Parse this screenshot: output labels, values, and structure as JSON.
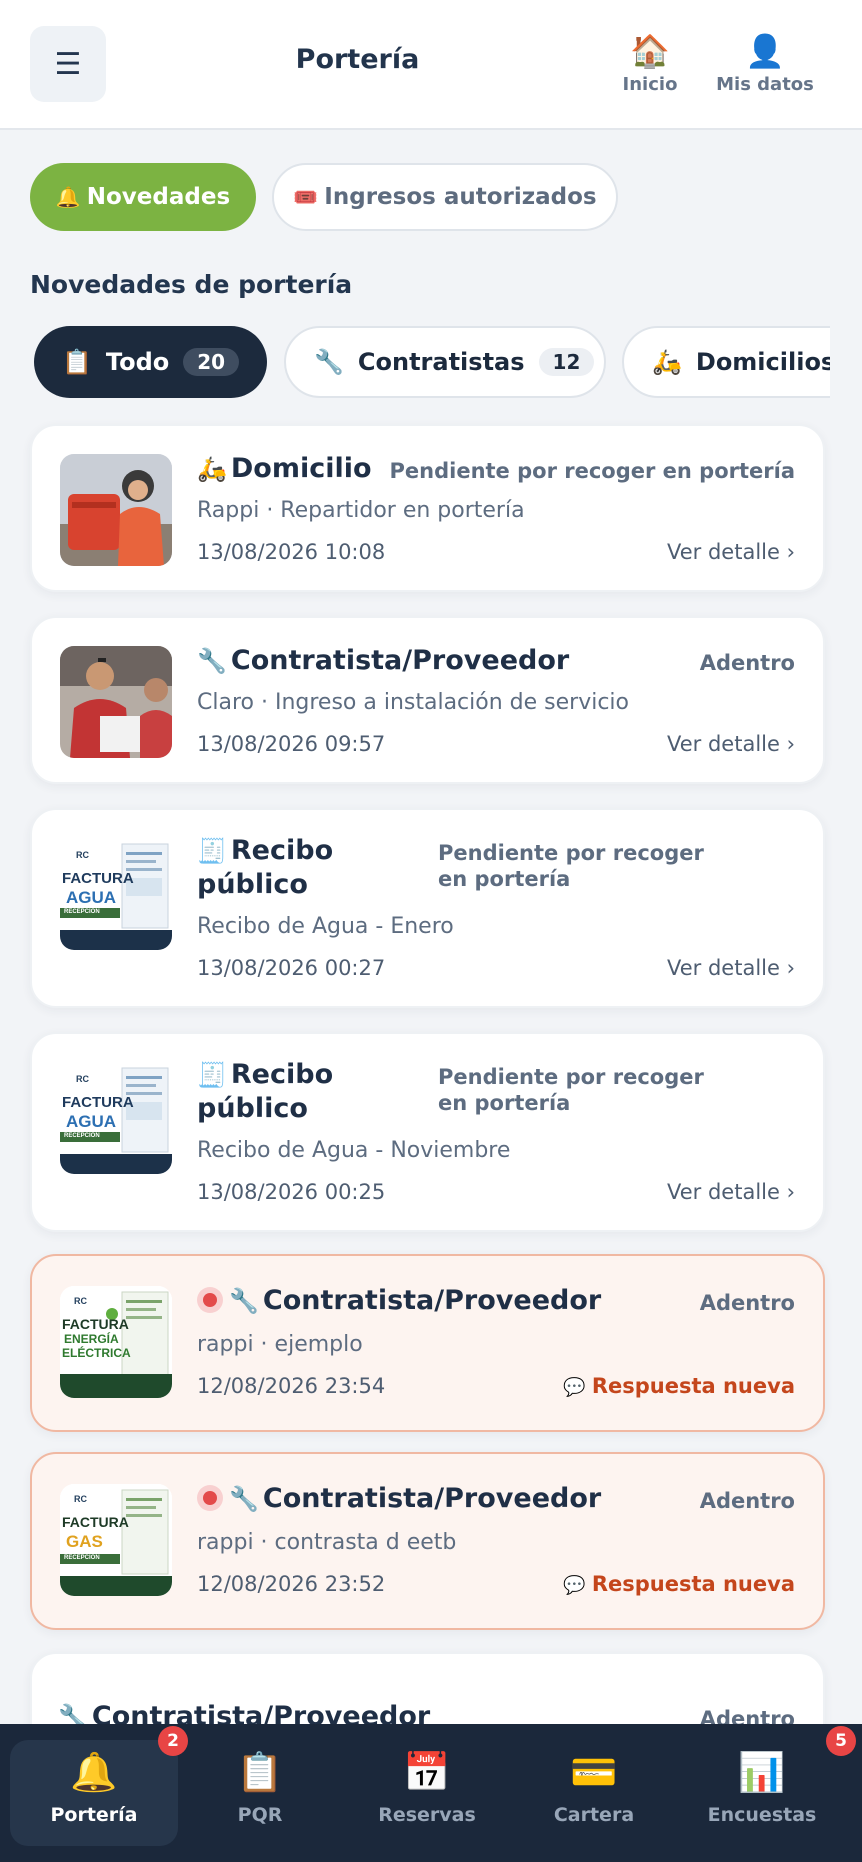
{
  "header": {
    "title": "Portería",
    "menu_icon": "menu-icon",
    "nav": [
      {
        "label": "Inicio",
        "icon": "house-icon"
      },
      {
        "label": "Mis datos",
        "icon": "user-icon"
      }
    ]
  },
  "top_tabs": [
    {
      "label": "Novedades",
      "icon": "bell-icon",
      "active": true
    },
    {
      "label": "Ingresos autorizados",
      "icon": "ticket-icon",
      "active": false
    }
  ],
  "section_title": "Novedades de portería",
  "filters": [
    {
      "label": "Todo",
      "count": "20",
      "icon": "clipboard-icon",
      "active": true
    },
    {
      "label": "Contratistas",
      "count": "12",
      "icon": "wrench-icon",
      "active": false
    },
    {
      "label": "Domicilios",
      "count": "",
      "icon": "scooter-icon",
      "active": false
    }
  ],
  "cards": [
    {
      "type": "Domicilio",
      "icon": "scooter-icon",
      "status": "Pendiente por recoger en portería",
      "subtitle": "Rappi · Repartidor en portería",
      "date": "13/08/2026 10:08",
      "action": "Ver detalle ›",
      "unread": false
    },
    {
      "type": "Contratista/Proveedor",
      "icon": "wrench-icon",
      "status": "Adentro",
      "subtitle": "Claro · Ingreso a instalación de servicio",
      "date": "13/08/2026 09:57",
      "action": "Ver detalle ›",
      "unread": false
    },
    {
      "type": "Recibo público",
      "icon": "receipt-icon",
      "status": "Pendiente por recoger en portería",
      "subtitle": "Recibo de Agua - Enero",
      "date": "13/08/2026 00:27",
      "action": "Ver detalle ›",
      "unread": false
    },
    {
      "type": "Recibo público",
      "icon": "receipt-icon",
      "status": "Pendiente por recoger en portería",
      "subtitle": "Recibo de Agua - Noviembre",
      "date": "13/08/2026 00:25",
      "action": "Ver detalle ›",
      "unread": false
    },
    {
      "type": "Contratista/Proveedor",
      "icon": "wrench-icon",
      "status": "Adentro",
      "subtitle": "rappi · ejemplo",
      "date": "12/08/2026 23:54",
      "action": "Respuesta nueva",
      "action_icon": "speech-bubble-icon",
      "unread": true
    },
    {
      "type": "Contratista/Proveedor",
      "icon": "wrench-icon",
      "status": "Adentro",
      "subtitle": "rappi · contrasta d eetb",
      "date": "12/08/2026 23:52",
      "action": "Respuesta nueva",
      "action_icon": "speech-bubble-icon",
      "unread": true
    },
    {
      "type": "Contratista/Proveedor",
      "icon": "wrench-icon",
      "status": "Adentro",
      "subtitle": "",
      "date": "",
      "action": "",
      "unread": false
    }
  ],
  "thumb_text": {
    "rc": "RC",
    "factura": "FACTURA",
    "agua": "AGUA",
    "recepcion": "RECEPCIÓN",
    "energia": "ENERGÍA",
    "electrica": "ELÉCTRICA",
    "gas": "GAS"
  },
  "bottom_nav": [
    {
      "label": "Portería",
      "icon": "bell-icon",
      "badge": "2",
      "active": true
    },
    {
      "label": "PQR",
      "icon": "clipboard-icon",
      "badge": "",
      "active": false
    },
    {
      "label": "Reservas",
      "icon": "calendar-icon",
      "badge": "",
      "active": false
    },
    {
      "label": "Cartera",
      "icon": "credit-card-icon",
      "badge": "",
      "active": false
    },
    {
      "label": "Encuestas",
      "icon": "bar-chart-icon",
      "badge": "5",
      "active": false
    }
  ],
  "colors": {
    "accent_green": "#7cb342",
    "dark_navy": "#1b283b",
    "alert_orange": "#c4461c",
    "highlight_border": "#f0b8a2",
    "badge_red": "#e84545"
  }
}
